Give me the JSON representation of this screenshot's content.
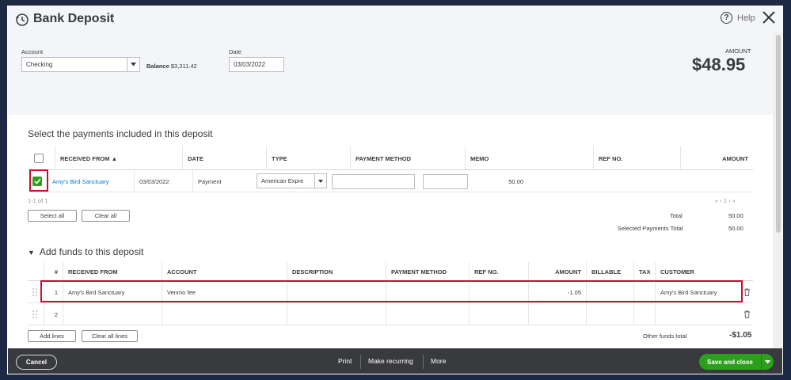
{
  "header": {
    "title": "Bank Deposit",
    "help_label": "Help"
  },
  "top": {
    "account_label": "Account",
    "account_value": "Checking",
    "balance_label": "Balance",
    "balance_value": "$3,311.42",
    "date_label": "Date",
    "date_value": "03/03/2022",
    "amount_label": "AMOUNT",
    "amount_value": "$48.95"
  },
  "payments": {
    "title": "Select the payments included in this deposit",
    "columns": [
      "RECEIVED FROM ▲",
      "DATE",
      "TYPE",
      "PAYMENT METHOD",
      "MEMO",
      "REF NO.",
      "AMOUNT"
    ],
    "rows": [
      {
        "received_from": "Amy's Bird Sanctuary",
        "date": "03/03/2022",
        "type": "Payment",
        "payment_method": "American Expre",
        "memo": "",
        "ref_no": "",
        "amount": "50.00",
        "checked": true
      }
    ],
    "pager_text": "1-1 of 1",
    "pager_nav": "« ‹ 1 › »",
    "select_all_label": "Select all",
    "clear_all_label": "Clear all",
    "total_label": "Total",
    "total_value": "50.00",
    "selected_total_label": "Selected Payments Total",
    "selected_total_value": "50.00"
  },
  "funds": {
    "title": "Add funds to this deposit",
    "columns": [
      "#",
      "RECEIVED FROM",
      "ACCOUNT",
      "DESCRIPTION",
      "PAYMENT METHOD",
      "REF NO.",
      "AMOUNT",
      "BILLABLE",
      "TAX",
      "CUSTOMER"
    ],
    "rows": [
      {
        "num": "1",
        "received_from": "Amy's Bird Sanctuary",
        "account": "Venmo fee",
        "description": "",
        "payment_method": "",
        "ref_no": "",
        "amount": "-1.05",
        "billable": "",
        "tax": "",
        "customer": "Amy's Bird Sanctuary"
      },
      {
        "num": "2",
        "received_from": "",
        "account": "",
        "description": "",
        "payment_method": "",
        "ref_no": "",
        "amount": "",
        "billable": "",
        "tax": "",
        "customer": ""
      }
    ],
    "add_lines_label": "Add lines",
    "clear_all_lines_label": "Clear all lines",
    "other_total_label": "Other funds total",
    "other_total_value": "-$1.05"
  },
  "footer": {
    "cancel_label": "Cancel",
    "print_label": "Print",
    "recurring_label": "Make recurring",
    "more_label": "More",
    "save_label": "Save and close"
  },
  "colors": {
    "accent_green": "#2ca01c",
    "link_blue": "#0077c5",
    "highlight_red": "#c8102e",
    "footer_bg": "#393a3d"
  }
}
